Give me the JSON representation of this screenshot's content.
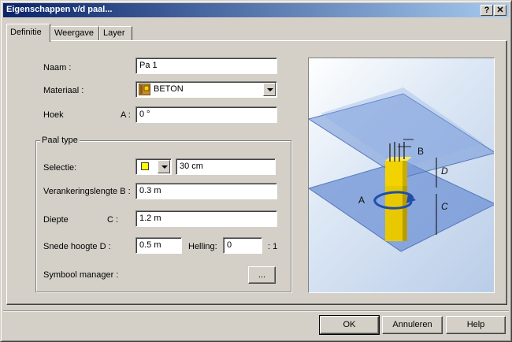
{
  "window": {
    "title": "Eigenschappen v/d paal...",
    "help_glyph": "?",
    "close_glyph": "✕"
  },
  "tabs": [
    {
      "label": "Definitie",
      "active": true
    },
    {
      "label": "Weergave",
      "active": false
    },
    {
      "label": "Layer",
      "active": false
    }
  ],
  "form": {
    "naam_label": "Naam :",
    "naam_value": "Pa 1",
    "materiaal_label": "Materiaal :",
    "materiaal_value": "BETON",
    "hoek_label": "Hoek",
    "hoek_letter": "A :",
    "hoek_value": "0 °"
  },
  "paal_type": {
    "group_label": "Paal type",
    "selectie_label": "Selectie:",
    "selectie_value": "30 cm",
    "verankering_label": "Verankeringslengte B :",
    "verankering_value": "0.3 m",
    "diepte_label": "Diepte",
    "diepte_letter": "C :",
    "diepte_value": "1.2 m",
    "snede_label": "Snede hoogte D :",
    "snede_value": "0.5 m",
    "helling_label": "Helling:",
    "helling_value": "0",
    "helling_suffix": ": 1",
    "symbool_label": "Symbool manager :",
    "symbool_button": "..."
  },
  "preview": {
    "label_a": "A",
    "label_b": "B",
    "label_c": "C",
    "label_d": "D"
  },
  "buttons": {
    "ok": "OK",
    "cancel": "Annuleren",
    "help": "Help"
  },
  "colors": {
    "titlebar_start": "#0a246a",
    "titlebar_end": "#a6caf0",
    "face": "#d4d0c8",
    "pile": "#f2d200",
    "plane": "#6f93d6"
  }
}
